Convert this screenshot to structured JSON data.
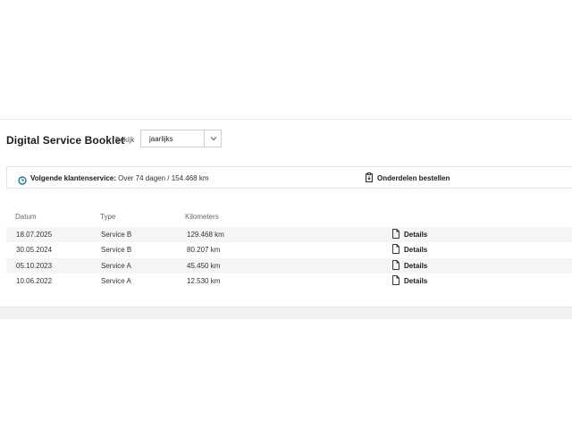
{
  "booklet": {
    "title": "Digital Service Booklet",
    "view_label": "Bekijk",
    "view_select": {
      "value": "jaarlijks"
    }
  },
  "info_bar": {
    "next_service_label": "Volgende klantenservice:",
    "next_service_value": " Over 74 dagen / 154.468 km",
    "order_parts_label": "Onderdelen bestellen"
  },
  "table": {
    "headers": {
      "date": "Datum",
      "type": "Type",
      "km": "Kilometers"
    },
    "rows": [
      {
        "date": "18.07.2025",
        "type": "Service B",
        "km": "129.468 km",
        "action": "Details"
      },
      {
        "date": "30.05.2024",
        "type": "Service B",
        "km": "80.207 km",
        "action": "Details"
      },
      {
        "date": "05.10.2023",
        "type": "Service A",
        "km": "45.450 km",
        "action": "Details"
      },
      {
        "date": "10.06.2022",
        "type": "Service A",
        "km": "12.530 km",
        "action": "Details"
      }
    ]
  },
  "icons": {
    "select": "chevron-down-icon",
    "next_service": "clock-icon",
    "order_parts": "parts-icon",
    "details": "document-icon"
  },
  "colors": {
    "accent": "#00677f",
    "row_alt": "#f5f5f5"
  }
}
